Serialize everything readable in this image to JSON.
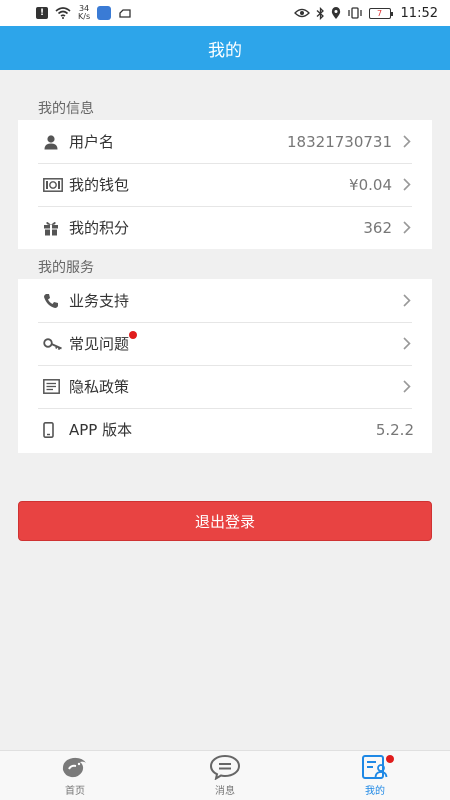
{
  "status_bar": {
    "alert_badge": "!",
    "net_speed_value": "34",
    "net_speed_unit": "K/s",
    "battery_level": "7",
    "time": "11:52"
  },
  "header": {
    "title": "我的"
  },
  "info_section": {
    "title": "我的信息",
    "items": [
      {
        "icon": "user-icon",
        "label": "用户名",
        "value": "18321730731"
      },
      {
        "icon": "wallet-icon",
        "label": "我的钱包",
        "value": "¥0.04"
      },
      {
        "icon": "gift-icon",
        "label": "我的积分",
        "value": "362"
      }
    ]
  },
  "service_section": {
    "title": "我的服务",
    "items": [
      {
        "icon": "phone-icon",
        "label": "业务支持",
        "value": ""
      },
      {
        "icon": "key-icon",
        "label": "常见问题",
        "value": ""
      },
      {
        "icon": "document-icon",
        "label": "隐私政策",
        "value": ""
      },
      {
        "icon": "mobile-icon",
        "label": "APP 版本",
        "value": "5.2.2"
      }
    ]
  },
  "logout_button": {
    "label": "退出登录"
  },
  "tabs": [
    {
      "icon": "home-icon",
      "label": "首页"
    },
    {
      "icon": "message-icon",
      "label": "消息"
    },
    {
      "icon": "profile-icon",
      "label": "我的"
    }
  ],
  "colors": {
    "header_bg": "#2da5ea",
    "logout_bg": "#e84342",
    "active_tab": "#1e88e5",
    "badge_red": "#e01c1c"
  }
}
